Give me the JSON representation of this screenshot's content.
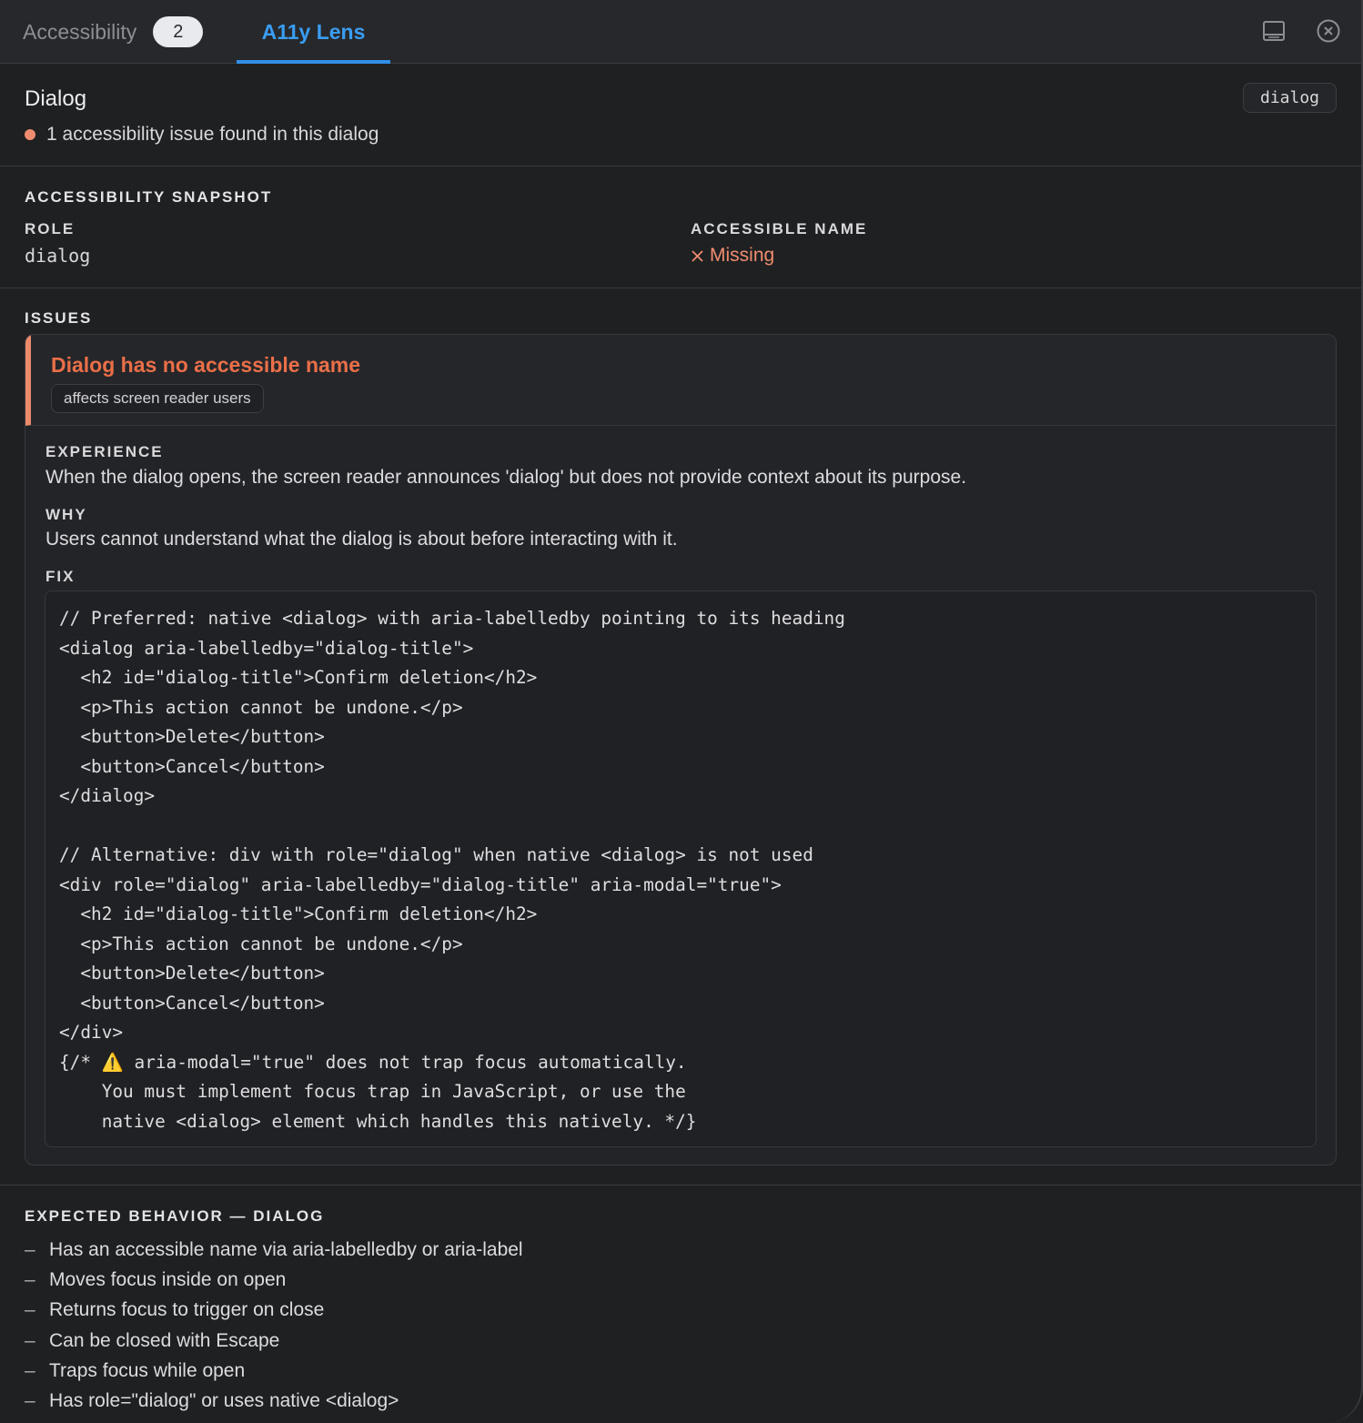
{
  "tabs": {
    "accessibility": {
      "label": "Accessibility",
      "badge": "2"
    },
    "lens": {
      "label": "A11y Lens"
    }
  },
  "header": {
    "title": "Dialog",
    "role_chip": "dialog",
    "issue_summary": "1 accessibility issue found in this dialog"
  },
  "snapshot": {
    "heading": "ACCESSIBILITY SNAPSHOT",
    "role_label": "ROLE",
    "role_value": "dialog",
    "name_label": "ACCESSIBLE NAME",
    "name_value": "Missing"
  },
  "issues": {
    "heading": "ISSUES",
    "items": [
      {
        "title": "Dialog has no accessible name",
        "impact": "affects screen reader users",
        "experience_label": "EXPERIENCE",
        "experience": "When the dialog opens, the screen reader announces 'dialog' but does not provide context about its purpose.",
        "why_label": "WHY",
        "why": "Users cannot understand what the dialog is about before interacting with it.",
        "fix_label": "FIX",
        "code": "// Preferred: native <dialog> with aria-labelledby pointing to its heading\n<dialog aria-labelledby=\"dialog-title\">\n  <h2 id=\"dialog-title\">Confirm deletion</h2>\n  <p>This action cannot be undone.</p>\n  <button>Delete</button>\n  <button>Cancel</button>\n</dialog>\n\n// Alternative: div with role=\"dialog\" when native <dialog> is not used\n<div role=\"dialog\" aria-labelledby=\"dialog-title\" aria-modal=\"true\">\n  <h2 id=\"dialog-title\">Confirm deletion</h2>\n  <p>This action cannot be undone.</p>\n  <button>Delete</button>\n  <button>Cancel</button>\n</div>\n{/* ⚠️ aria-modal=\"true\" does not trap focus automatically.\n    You must implement focus trap in JavaScript, or use the\n    native <dialog> element which handles this natively. */}"
      }
    ]
  },
  "expected": {
    "heading": "EXPECTED BEHAVIOR — DIALOG",
    "items": [
      "Has an accessible name via aria-labelledby or aria-label",
      "Moves focus inside on open",
      "Returns focus to trigger on close",
      "Can be closed with Escape",
      "Traps focus while open",
      "Has role=\"dialog\" or uses native <dialog>"
    ],
    "bullet": "–"
  },
  "colors": {
    "accent": "#3a9df3",
    "error": "#ea6f48",
    "warning_dot": "#ef8c6f",
    "background": "#1f2022"
  },
  "icons": {
    "dock": "dock-bottom-icon",
    "close": "close-circle-icon",
    "missing": "x-icon",
    "status": "status-dot-icon"
  }
}
